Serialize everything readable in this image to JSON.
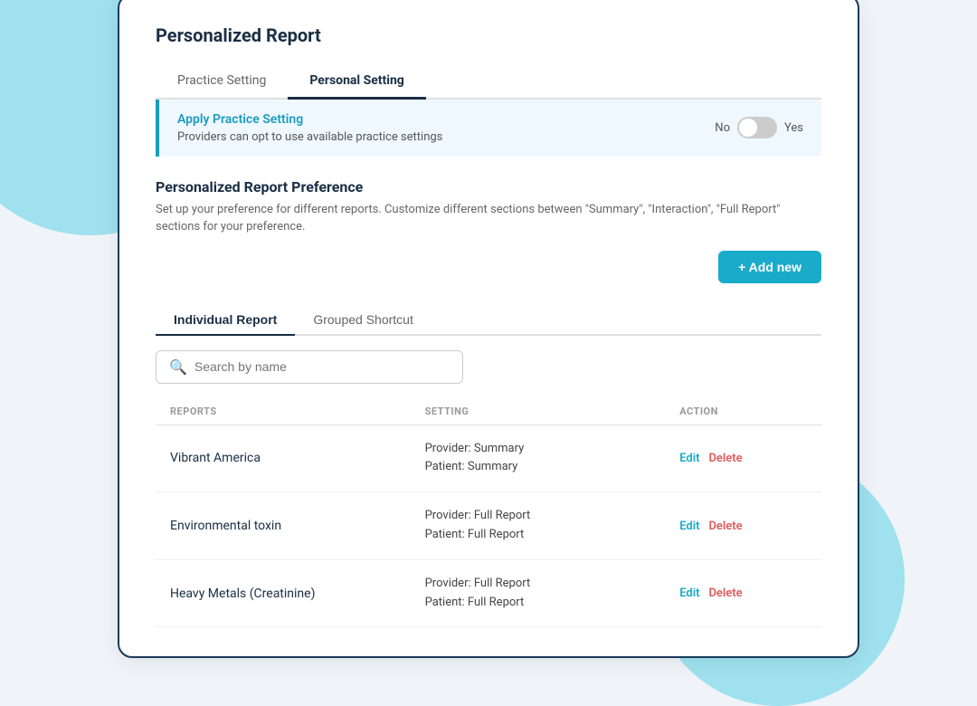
{
  "background": {
    "blob_color": "#4ecde4"
  },
  "card": {
    "title": "Personalized Report",
    "tabs": [
      {
        "id": "practice",
        "label": "Practice Setting",
        "active": false
      },
      {
        "id": "personal",
        "label": "Personal Setting",
        "active": true
      }
    ],
    "apply_setting": {
      "title": "Apply Practice Setting",
      "description": "Providers can opt to use available practice settings",
      "toggle_no": "No",
      "toggle_yes": "Yes"
    },
    "preference_section": {
      "title": "Personalized Report Preference",
      "description": "Set up your preference for different reports. Customize different sections between \"Summary\", \"Interaction\", \"Full Report\" sections for your preference.",
      "add_button_label": "+ Add new"
    },
    "sub_tabs": [
      {
        "id": "individual",
        "label": "Individual Report",
        "active": true
      },
      {
        "id": "grouped",
        "label": "Grouped Shortcut",
        "active": false
      }
    ],
    "search": {
      "placeholder": "Search by name"
    },
    "table": {
      "headers": [
        {
          "id": "reports",
          "label": "REPORTS"
        },
        {
          "id": "setting",
          "label": "SETTING"
        },
        {
          "id": "action",
          "label": "ACTION"
        }
      ],
      "rows": [
        {
          "name": "Vibrant America",
          "setting_line1": "Provider: Summary",
          "setting_line2": "Patient: Summary",
          "edit_label": "Edit",
          "delete_label": "Delete"
        },
        {
          "name": "Environmental toxin",
          "setting_line1": "Provider: Full Report",
          "setting_line2": "Patient: Full Report",
          "edit_label": "Edit",
          "delete_label": "Delete"
        },
        {
          "name": "Heavy Metals (Creatinine)",
          "setting_line1": "Provider: Full Report",
          "setting_line2": "Patient: Full Report",
          "edit_label": "Edit",
          "delete_label": "Delete"
        }
      ]
    }
  }
}
